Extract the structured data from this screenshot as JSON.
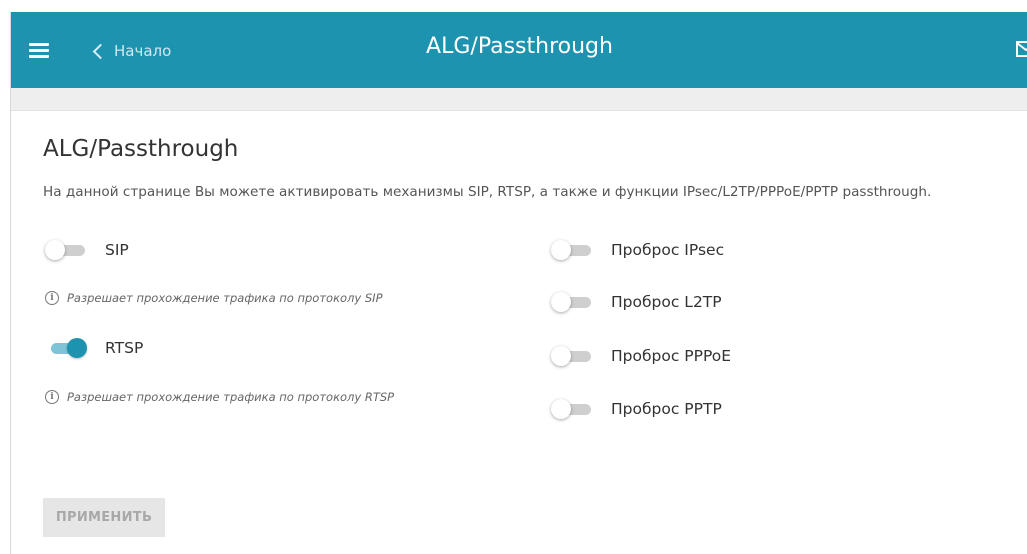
{
  "header": {
    "back_label": "Начало",
    "title": "ALG/Passthrough",
    "accent_color": "#1e93b0"
  },
  "main": {
    "title": "ALG/Passthrough",
    "description": "На данной странице Вы можете активировать механизмы SIP, RTSP, а также и функции IPsec/L2TP/PPPoE/PPTP passthrough.",
    "left_toggles": [
      {
        "label": "SIP",
        "on": false,
        "hint": "Разрешает прохождение трафика по протоколу SIP"
      },
      {
        "label": "RTSP",
        "on": true,
        "hint": "Разрешает прохождение трафика по протоколу RTSP"
      }
    ],
    "right_toggles": [
      {
        "label": "Проброс IPsec",
        "on": false
      },
      {
        "label": "Проброс L2TP",
        "on": false
      },
      {
        "label": "Проброс PPPoE",
        "on": false
      },
      {
        "label": "Проброс PPTP",
        "on": false
      }
    ],
    "apply_label": "ПРИМЕНИТЬ"
  },
  "icons": [
    "menu-icon",
    "chevron-left-icon",
    "mail-icon",
    "info-icon"
  ]
}
